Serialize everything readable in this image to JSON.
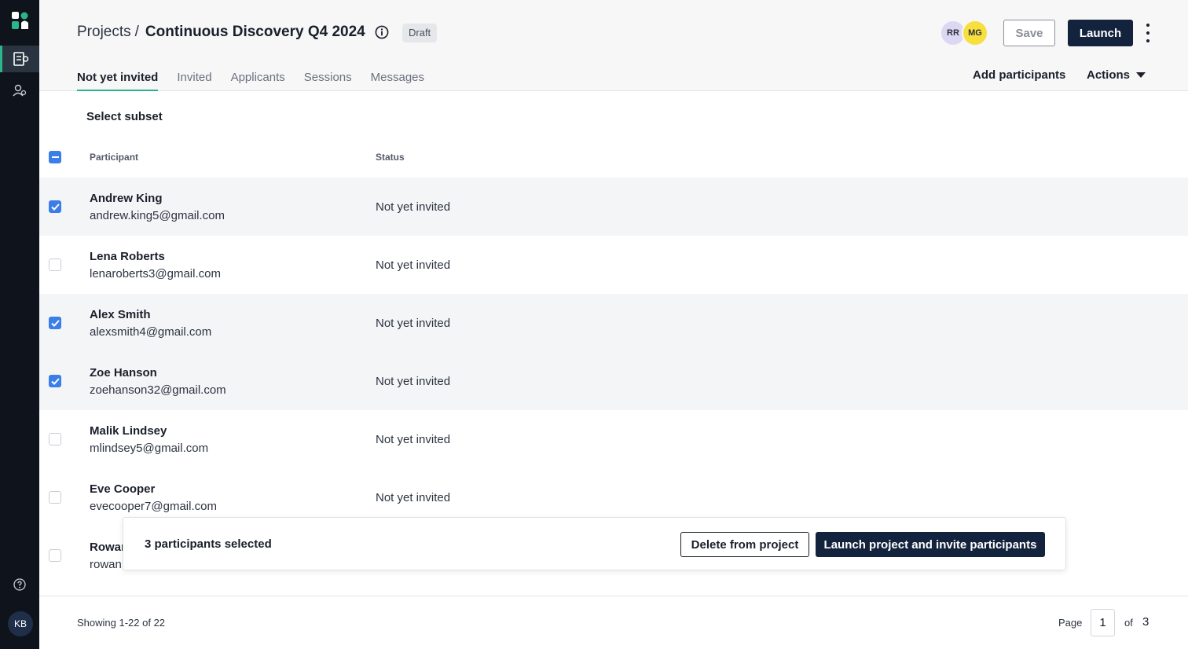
{
  "rail": {
    "user_initials": "KB",
    "icons": [
      "app-logo-icon",
      "projects-icon",
      "participants-icon",
      "help-icon"
    ]
  },
  "header": {
    "breadcrumb_root": "Projects",
    "breadcrumb_sep": "/",
    "project_title": "Continuous Discovery Q4 2024",
    "status_badge": "Draft",
    "collaborators": [
      "RR",
      "MG"
    ],
    "save_label": "Save",
    "launch_label": "Launch"
  },
  "tabs": [
    {
      "label": "Not yet invited",
      "active": true
    },
    {
      "label": "Invited",
      "active": false
    },
    {
      "label": "Applicants",
      "active": false
    },
    {
      "label": "Sessions",
      "active": false
    },
    {
      "label": "Messages",
      "active": false
    }
  ],
  "toolbar": {
    "add_participants_label": "Add participants",
    "actions_label": "Actions"
  },
  "table": {
    "select_subset_label": "Select subset",
    "columns": [
      "Participant",
      "Status"
    ],
    "rows": [
      {
        "name": "Andrew King",
        "email": "andrew.king5@gmail.com",
        "status": "Not yet invited",
        "checked": true
      },
      {
        "name": "Lena Roberts",
        "email": "lenaroberts3@gmail.com",
        "status": "Not yet invited",
        "checked": false
      },
      {
        "name": "Alex Smith",
        "email": "alexsmith4@gmail.com",
        "status": "Not yet invited",
        "checked": true
      },
      {
        "name": "Zoe Hanson",
        "email": "zoehanson32@gmail.com",
        "status": "Not yet invited",
        "checked": true
      },
      {
        "name": "Malik Lindsey",
        "email": "mlindsey5@gmail.com",
        "status": "Not yet invited",
        "checked": false
      },
      {
        "name": "Eve Cooper",
        "email": "evecooper7@gmail.com",
        "status": "Not yet invited",
        "checked": false
      },
      {
        "name": "Rowan",
        "email": "rowan",
        "status": "",
        "checked": false
      }
    ]
  },
  "selection_bar": {
    "count_text": "3 participants selected",
    "delete_label": "Delete from project",
    "launch_invite_label": "Launch project and invite participants"
  },
  "pagination": {
    "showing_text": "Showing 1-22 of 22",
    "page_label": "Page",
    "current_page": "1",
    "of_label": "of",
    "total_pages": "3"
  },
  "colors": {
    "rail_bg": "#0f141c",
    "primary_navy": "#14233d",
    "accent_green": "#2bb58a",
    "checkbox_blue": "#3b7de9"
  }
}
